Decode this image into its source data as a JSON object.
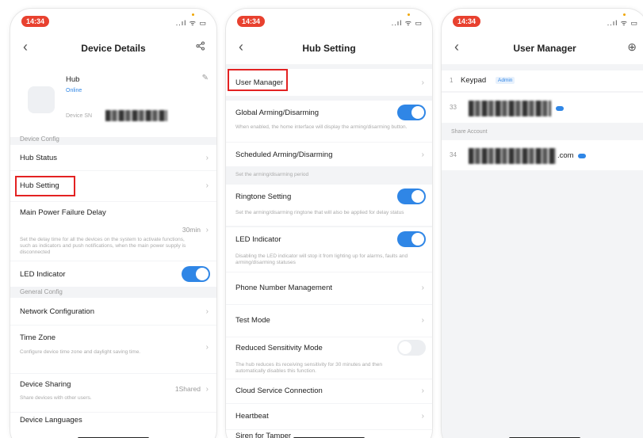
{
  "status_bar": {
    "time": "14:34",
    "icons": "..ıl ᯤ ▭"
  },
  "device_details": {
    "title": "Device Details",
    "device_name": "Hub",
    "online": "Online",
    "sn_label": "Device SN",
    "device_config_label": "Device Config",
    "hub_status": "Hub Status",
    "hub_setting": "Hub Setting",
    "main_power_failure_delay": "Main Power Failure Delay",
    "main_power_value": "30min",
    "main_power_desc": "Set the delay time for all the devices on the system to activate functions, such as indicators and push notifications, when the main power supply is disconnected",
    "led_indicator": "LED Indicator",
    "general_config_label": "General Config",
    "network_configuration": "Network Configuration",
    "time_zone": "Time Zone",
    "time_zone_desc": "Configure device time zone and daylight saving time.",
    "device_sharing": "Device Sharing",
    "device_sharing_value": "1Shared",
    "device_sharing_desc": "Share devices with other users.",
    "device_languages": "Device Languages"
  },
  "hub_setting": {
    "title": "Hub Setting",
    "user_manager": "User Manager",
    "global_arming": "Global Arming/Disarming",
    "global_arming_desc": "When enabled, the home interface will display the arming/disarming button.",
    "scheduled_arming": "Scheduled Arming/Disarming",
    "scheduled_arming_desc": "Set the arming/disarming period",
    "ringtone_setting": "Ringtone Setting",
    "ringtone_desc": "Set the arming/disarming ringtone that will also be applied for delay status",
    "led_indicator": "LED Indicator",
    "led_desc": "Disabling the LED indicator will stop it from lighting up for alarms, faults and arming/disarming statuses",
    "phone_number_management": "Phone Number Management",
    "test_mode": "Test Mode",
    "reduced_sensitivity": "Reduced Sensitivity Mode",
    "reduced_sensitivity_desc": "The hub reduces its receiving sensitivity for 30 minutes and then automatically disables this function.",
    "cloud_service": "Cloud Service Connection",
    "heartbeat": "Heartbeat",
    "siren_for_tamper": "Siren for Tamper"
  },
  "user_manager": {
    "title": "User Manager",
    "keypad_index": "1",
    "keypad_label": "Keypad",
    "admin_badge": "Admin",
    "user1_index": "33",
    "share_account_label": "Share Account",
    "user2_index": "34",
    "user2_suffix": ".com"
  },
  "colors": {
    "accent": "#2f86e6",
    "highlight": "#e32222",
    "clock_badge": "#e8412f"
  }
}
